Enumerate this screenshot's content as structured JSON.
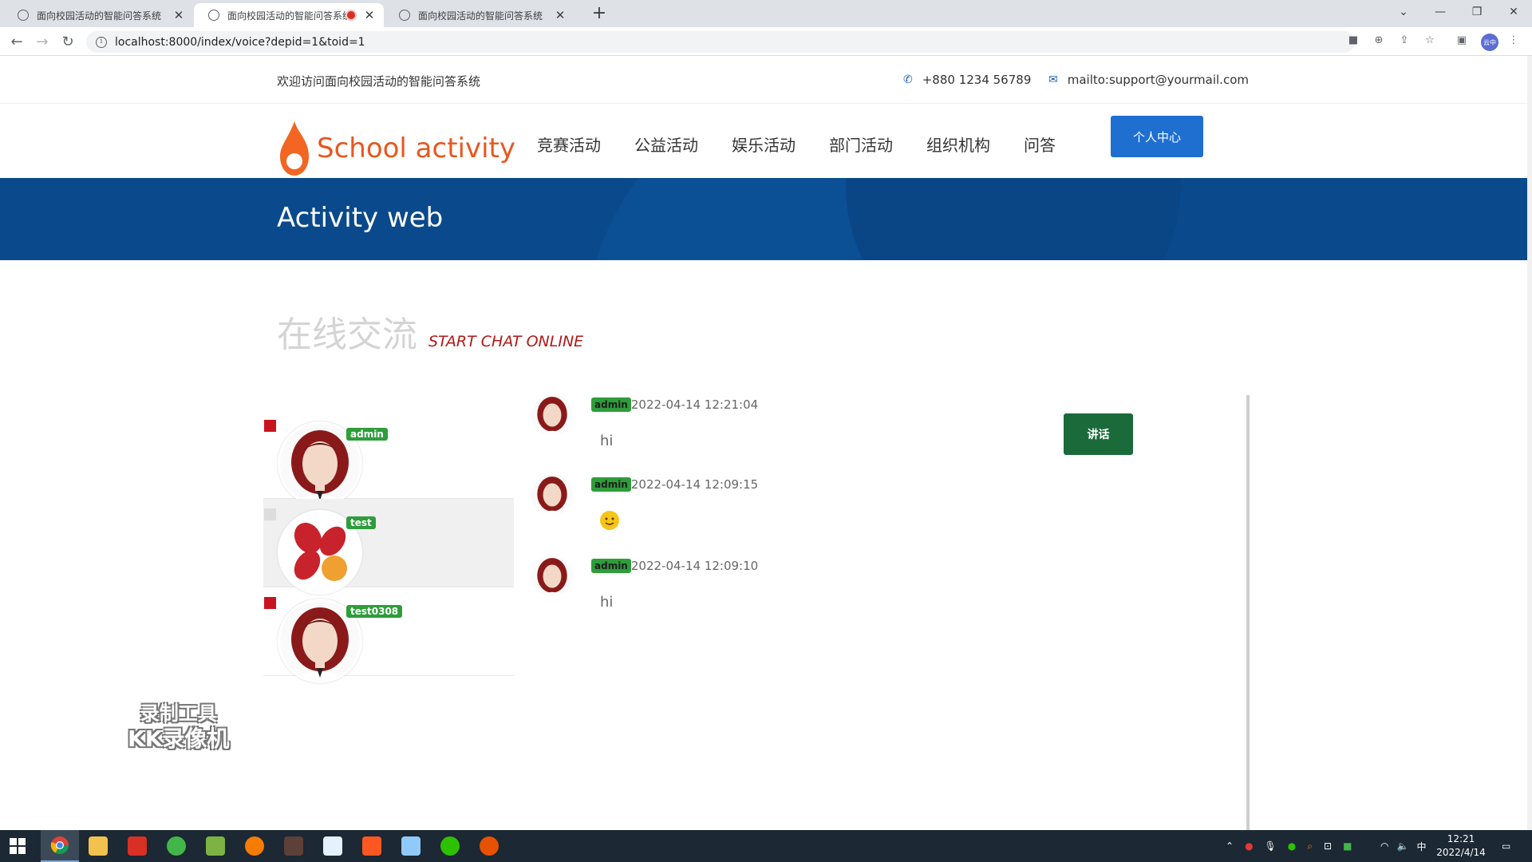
{
  "browser": {
    "tabs": [
      {
        "title": "面向校园活动的智能问答系统",
        "active": false,
        "recording": false
      },
      {
        "title": "面向校园活动的智能问答系统",
        "active": true,
        "recording": true
      },
      {
        "title": "面向校园活动的智能问答系统",
        "active": false,
        "recording": false
      }
    ],
    "url": "localhost:8000/index/voice?depid=1&toid=1",
    "profile_label": "云中"
  },
  "topbar": {
    "welcome": "欢迎访问面向校园活动的智能问答系统",
    "phone": "+880 1234 56789",
    "email": "mailto:support@yourmail.com"
  },
  "header": {
    "logo_text": "School activity",
    "nav": [
      "竞赛活动",
      "公益活动",
      "娱乐活动",
      "部门活动",
      "组织机构",
      "问答"
    ],
    "personal_center": "个人中心"
  },
  "banner": {
    "title": "Activity web"
  },
  "section": {
    "title_zh": "在线交流",
    "title_en": "START CHAT ONLINE"
  },
  "users": [
    {
      "name": "admin",
      "avatar": "portrait",
      "selected": false,
      "online": true
    },
    {
      "name": "test",
      "avatar": "logo",
      "selected": true,
      "online": false
    },
    {
      "name": "test0308",
      "avatar": "portrait",
      "selected": false,
      "online": true
    }
  ],
  "messages": [
    {
      "user": "admin",
      "time": "2022-04-14 12:21:04",
      "text": "hi"
    },
    {
      "user": "admin",
      "time": "2022-04-14 12:09:15",
      "text": "",
      "emoji": "smiley-emoji"
    },
    {
      "user": "admin",
      "time": "2022-04-14 12:09:10",
      "text": "hi"
    }
  ],
  "speak_button": "讲话",
  "watermark": {
    "line1": "录制工具",
    "line2": "KK录像机"
  },
  "taskbar": {
    "time": "12:21",
    "date": "2022/4/14",
    "ime": "中"
  },
  "colors": {
    "banner": "#0a4a8c",
    "accent_blue": "#1e6fd0",
    "logo_orange": "#e8571f",
    "badge_green": "#2e9d3a",
    "speak_green": "#1a6a3a",
    "section_red": "#b01919"
  }
}
